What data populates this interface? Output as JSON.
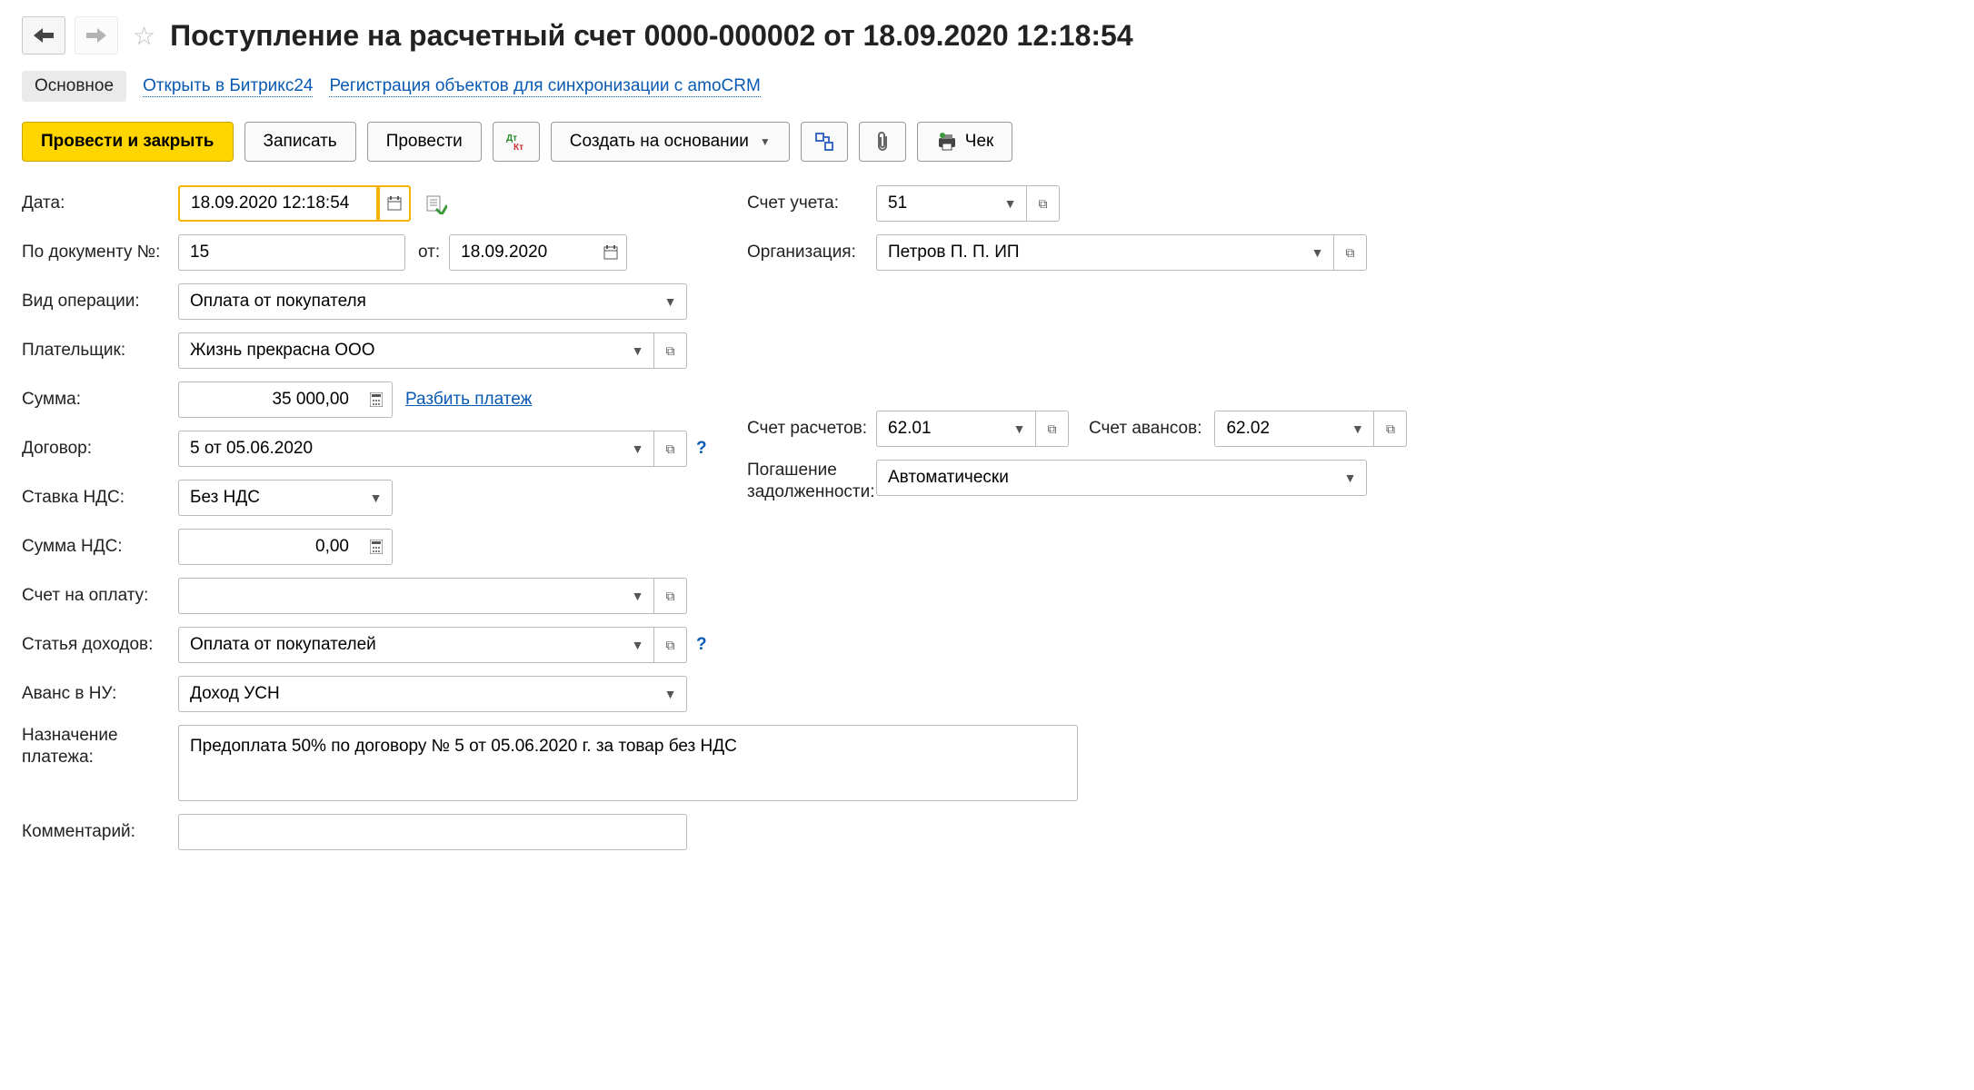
{
  "header": {
    "title": "Поступление на расчетный счет 0000-000002 от 18.09.2020 12:18:54"
  },
  "tabs": {
    "main": "Основное",
    "bitrix": "Открыть в Битрикс24",
    "amo": "Регистрация объектов для синхронизации с amoCRM"
  },
  "toolbar": {
    "post_close": "Провести и закрыть",
    "save": "Записать",
    "post": "Провести",
    "create_based": "Создать на основании",
    "cheque": "Чек"
  },
  "labels": {
    "date": "Дата:",
    "doc_no": "По документу №:",
    "from": "от:",
    "op_type": "Вид операции:",
    "payer": "Плательщик:",
    "sum": "Сумма:",
    "split": "Разбить платеж",
    "contract": "Договор:",
    "vat_rate": "Ставка НДС:",
    "vat_sum": "Сумма НДС:",
    "invoice": "Счет на оплату:",
    "income_item": "Статья доходов:",
    "advance_nu": "Аванс в НУ:",
    "purpose": "Назначение платежа:",
    "comment": "Комментарий:",
    "account": "Счет учета:",
    "org": "Организация:",
    "settle_acc": "Счет расчетов:",
    "advance_acc": "Счет авансов:",
    "debt_repay": "Погашение задолженности:"
  },
  "values": {
    "date": "18.09.2020 12:18:54",
    "doc_no": "15",
    "doc_date": "18.09.2020",
    "op_type": "Оплата от покупателя",
    "payer": "Жизнь прекрасна ООО",
    "sum": "35 000,00",
    "contract": "5 от 05.06.2020",
    "vat_rate": "Без НДС",
    "vat_sum": "0,00",
    "invoice": "",
    "income_item": "Оплата от покупателей",
    "advance_nu": "Доход УСН",
    "purpose": "Предоплата 50% по договору № 5 от 05.06.2020 г. за товар без НДС",
    "comment": "",
    "account": "51",
    "org": "Петров П. П. ИП",
    "settle_acc": "62.01",
    "advance_acc": "62.02",
    "debt_repay": "Автоматически"
  }
}
